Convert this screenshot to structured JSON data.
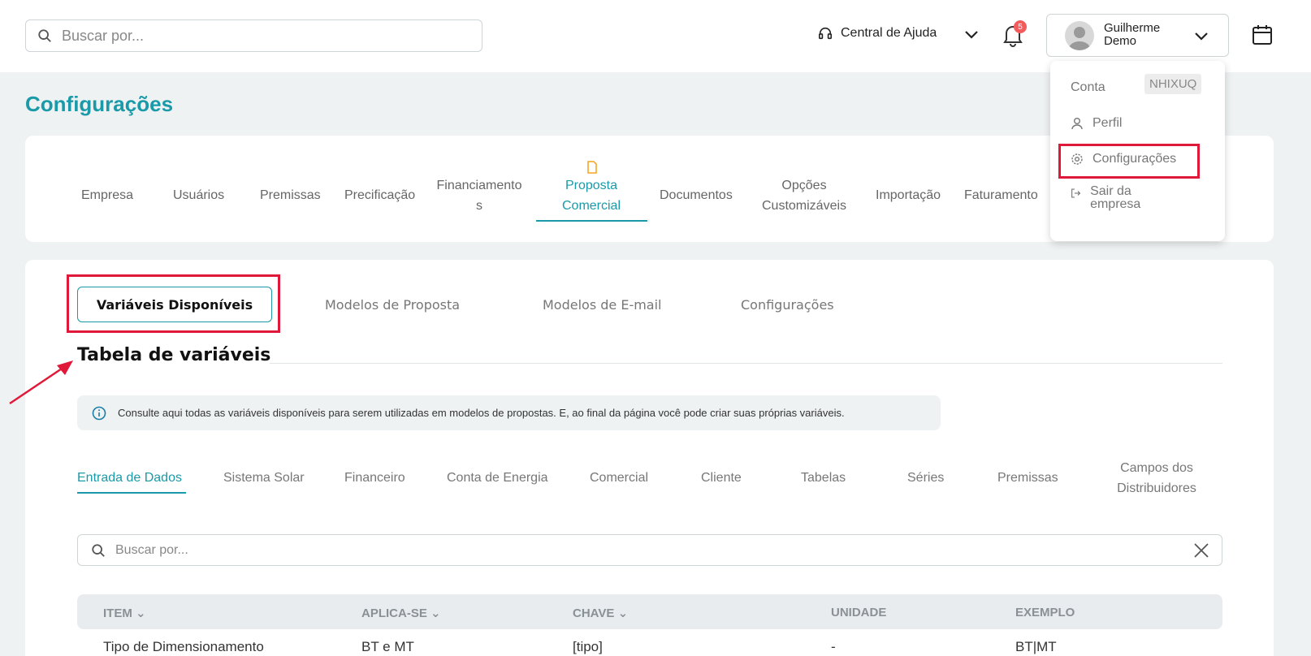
{
  "header": {
    "search_placeholder": "Buscar por...",
    "help_label": "Central de Ajuda",
    "notifications_count": "5",
    "user_name": "Guilherme Demo"
  },
  "page": {
    "title": "Configurações"
  },
  "main_nav": [
    {
      "label": "Empresa"
    },
    {
      "label": "Usuários"
    },
    {
      "label": "Premissas"
    },
    {
      "label": "Precificação"
    },
    {
      "label": "Financiamento s"
    },
    {
      "label": "Proposta Comercial",
      "active": true
    },
    {
      "label": "Documentos"
    },
    {
      "label": "Opções Customizáveis"
    },
    {
      "label": "Importação"
    },
    {
      "label": "Faturamento"
    }
  ],
  "sub_tabs": {
    "active": "Variáveis Disponíveis",
    "items": [
      "Modelos de Proposta",
      "Modelos de E-mail",
      "Configurações"
    ]
  },
  "section": {
    "title": "Tabela de variáveis",
    "info": "Consulte aqui todas as variáveis disponíveis para serem utilizadas em modelos de propostas. E, ao final da página você pode criar suas próprias variáveis."
  },
  "categories": [
    "Entrada de Dados",
    "Sistema Solar",
    "Financeiro",
    "Conta de Energia",
    "Comercial",
    "Cliente",
    "Tabelas",
    "Séries",
    "Premissas",
    "Campos dos Distribuidores"
  ],
  "table_search_placeholder": "Buscar por...",
  "table": {
    "headers": [
      "ITEM",
      "APLICA-SE",
      "CHAVE",
      "UNIDADE",
      "EXEMPLO"
    ],
    "rows": [
      [
        "Tipo de Dimensionamento",
        "BT e MT",
        "[tipo]",
        "-",
        "BT|MT"
      ]
    ]
  },
  "user_menu": {
    "account_label": "Conta",
    "account_code": "NHIXUQ",
    "profile": "Perfil",
    "settings": "Configurações",
    "logout": "Sair da empresa"
  },
  "colors": {
    "accent": "#1a9aa8",
    "highlight": "#e0193a"
  }
}
